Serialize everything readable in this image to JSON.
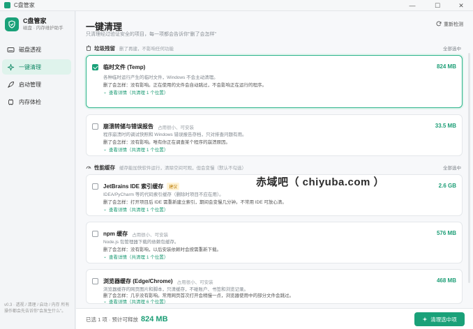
{
  "window": {
    "title": "C盘管家"
  },
  "brand": {
    "name": "C盘管家",
    "subtitle": "磁盘 · 内存维护助手"
  },
  "nav": [
    {
      "label": "磁盘透视",
      "icon": "disk-icon"
    },
    {
      "label": "一键清理",
      "icon": "sparkle-icon"
    },
    {
      "label": "启动管理",
      "icon": "rocket-icon"
    },
    {
      "label": "内存体检",
      "icon": "chip-icon"
    }
  ],
  "footer": "v0.3 · 透视 / 清理 / 启动 / 内存 所有操作都会先告诉你\"会发生什么\"。",
  "page": {
    "title": "一键清理",
    "subtitle": "只清理经过验证安全的项目，每一项都会告诉你\"删了会怎样\"",
    "rescan": "重新检测"
  },
  "sections": [
    {
      "title": "垃圾残留",
      "desc": "删了再建，不影响任何功能",
      "select_all": "全部选中"
    },
    {
      "title": "性能缓存",
      "desc": "缓存能加快软件运行，清除空间可观，但会变慢（默认不勾选）",
      "select_all": "全部选中"
    }
  ],
  "items": [
    {
      "title": "临时文件 (Temp)",
      "tag": "",
      "badge": "",
      "size": "824 MB",
      "checked": true,
      "line1": "各种临时运行产生的临时文件，Windows 不会主动清理。",
      "line2": "删了会怎样：没有影响。正在使用的文件会自动跳过，不会影响正在运行的程序。",
      "link": "查看详情（共清理 1 个位置）"
    },
    {
      "title": "崩溃转储与错误报告",
      "tag": "占用很小、可安装",
      "badge": "",
      "size": "33.5 MB",
      "checked": false,
      "line1": "程序崩溃时的调试快照和 Windows 错误报告存档，只对排查问题有用。",
      "line2": "删了会怎样：没有影响。唯有你正在调查某个程序的崩溃原因。",
      "link": "查看详情（共清理 1 个位置）"
    },
    {
      "title": "JetBrains IDE 索引缓存",
      "tag": "",
      "badge": "建议",
      "size": "2.6 GB",
      "checked": false,
      "line1": "IDEA/PyCharm 等的代码索引缓存（删除时项目不应在用）。",
      "line2": "删了会怎样：打开项目后 IDE 需重新建立索引，期间会变慢几分钟。不常用 IDE 可放心清。",
      "link": "查看详情（共清理 1 个位置）"
    },
    {
      "title": "npm 缓存",
      "tag": "占用很小、可安装",
      "badge": "",
      "size": "576 MB",
      "checked": false,
      "line1": "Node.js 包管理器下载的依赖包缓存。",
      "line2": "删了会怎样：没有影响，以后安装依赖时会按需重新下载。",
      "link": "查看详情（共清理 1 个位置）"
    },
    {
      "title": "浏览器缓存 (Edge/Chrome)",
      "tag": "占用很小、可安装",
      "badge": "",
      "size": "468 MB",
      "checked": false,
      "line1": "浏览器缓存的网页图片和脚本，只清缓存，不碰账户、书签和浏览记录。",
      "line2": "删了会怎样：几乎没有影响。常用网页首次打开会稍慢一点，浏览器使用中的部分文件会跳过。",
      "link": "查看详情（共清理 6 个位置）"
    }
  ],
  "watermark": "赤域吧（ chiyuba.com ）",
  "bottom": {
    "summary": "已选 1 项 · 预计可释放",
    "total": "824 MB",
    "button": "清理选中项"
  },
  "colors": {
    "accent": "#1aa179",
    "size": "#1d9e76"
  }
}
